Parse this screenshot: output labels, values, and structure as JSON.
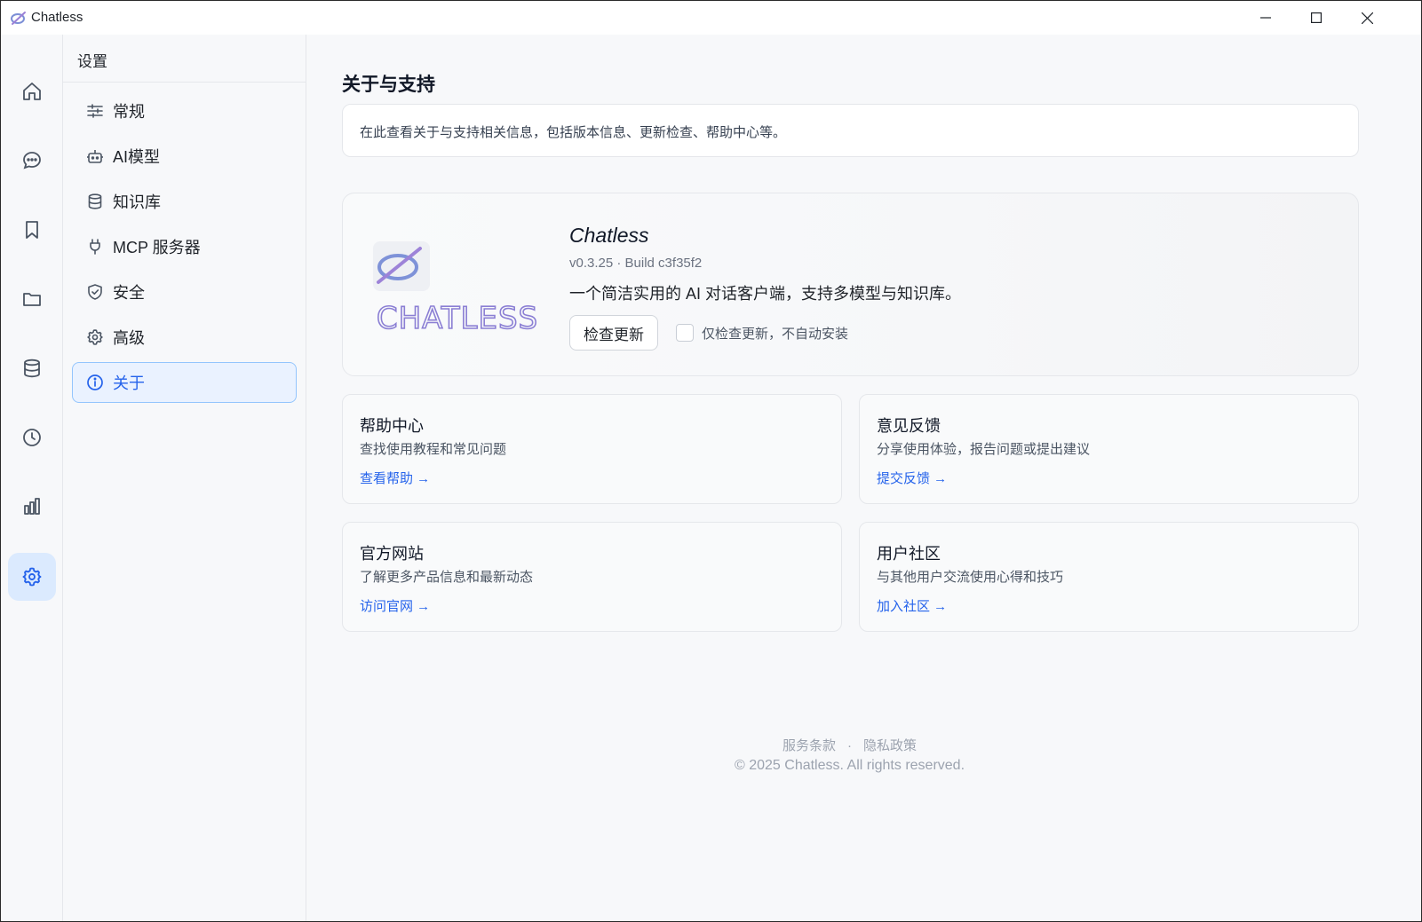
{
  "window": {
    "title": "Chatless",
    "controls": [
      "minimize",
      "maximize",
      "close"
    ]
  },
  "rail": {
    "items": [
      {
        "icon": "home-icon",
        "active": false
      },
      {
        "icon": "chat-bubble-icon",
        "active": false
      },
      {
        "icon": "bookmark-icon",
        "active": false
      },
      {
        "icon": "folder-icon",
        "active": false
      },
      {
        "icon": "database-icon",
        "active": false
      },
      {
        "icon": "clock-icon",
        "active": false
      },
      {
        "icon": "bar-chart-icon",
        "active": false
      },
      {
        "icon": "settings-gear-icon",
        "active": true
      }
    ]
  },
  "settings_nav": {
    "title": "设置",
    "items": [
      {
        "label": "常规",
        "icon": "sliders-icon"
      },
      {
        "label": "AI模型",
        "icon": "bot-icon"
      },
      {
        "label": "知识库",
        "icon": "database-icon"
      },
      {
        "label": "MCP 服务器",
        "icon": "plug-icon"
      },
      {
        "label": "安全",
        "icon": "shield-check-icon"
      },
      {
        "label": "高级",
        "icon": "gear-icon"
      },
      {
        "label": "关于",
        "icon": "info-icon",
        "active": true
      }
    ]
  },
  "main": {
    "title": "关于与支持",
    "description": "在此查看关于与支持相关信息，包括版本信息、更新检查、帮助中心等。",
    "about": {
      "logo_text": "CHATLESS",
      "app_name": "Chatless",
      "version": "v0.3.25 · Build c3f35f2",
      "tagline": "一个简洁实用的 AI 对话客户端，支持多模型与知识库。",
      "check_update_label": "检查更新",
      "only_check_label": "仅检查更新，不自动安装",
      "only_check_checked": false
    },
    "cards": [
      {
        "title": "帮助中心",
        "desc": "查找使用教程和常见问题",
        "link": "查看帮助 →"
      },
      {
        "title": "意见反馈",
        "desc": "分享使用体验，报告问题或提出建议",
        "link": "提交反馈 →"
      },
      {
        "title": "官方网站",
        "desc": "了解更多产品信息和最新动态",
        "link": "访问官网 →"
      },
      {
        "title": "用户社区",
        "desc": "与其他用户交流使用心得和技巧",
        "link": "加入社区 →"
      }
    ],
    "footer": {
      "terms": "服务条款",
      "separator": "·",
      "privacy": "隐私政策",
      "copyright": "© 2025 Chatless. All rights reserved."
    }
  },
  "colors": {
    "accent": "#2563eb",
    "active_bg": "#dbeafe",
    "nav_active_bg": "#eaf2ff",
    "logo_purple": "#8b7fd4"
  }
}
